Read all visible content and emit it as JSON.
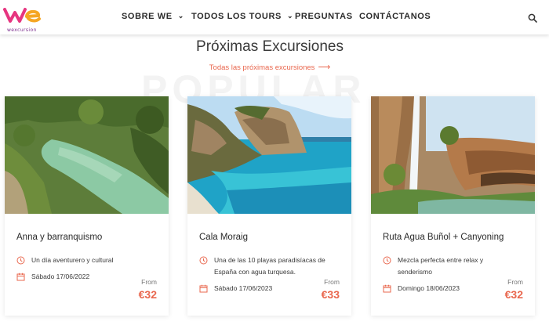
{
  "brand": {
    "logo_text": "wexcursion",
    "accent": "#e9674e",
    "logo_colors": [
      "#e63580",
      "#f5a623",
      "#7a2d8c"
    ]
  },
  "nav": {
    "items": [
      {
        "label": "SOBRE WE",
        "has_dropdown": true
      },
      {
        "label": "TODOS LOS TOURS",
        "has_dropdown": true
      },
      {
        "label": "PREGUNTAS",
        "has_dropdown": false
      },
      {
        "label": "CONTÁCTANOS",
        "has_dropdown": false
      }
    ],
    "search_icon": "search-icon"
  },
  "section": {
    "watermark": "POPULAR",
    "title": "Próximas Excursiones",
    "link": "Todas las próximas excursiones",
    "link_arrow": "⟶"
  },
  "cards": [
    {
      "title": "Anna y barranquismo",
      "description": "Un día aventurero y cultural",
      "date": "Sábado 17/06/2022",
      "from_label": "From",
      "price": "€32",
      "image": "green-lake-gorge"
    },
    {
      "title": "Cala Moraig",
      "description": "Una de las 10 playas paradisíacas de España con agua turquesa.",
      "date": "Sábado 17/06/2023",
      "from_label": "From",
      "price": "€33",
      "image": "turquoise-cove-cliffs"
    },
    {
      "title": "Ruta Agua Buñol + Canyoning",
      "description": "Mezcla perfecta entre relax y senderismo",
      "date": "Domingo 18/06/2023",
      "from_label": "From",
      "price": "€32",
      "image": "waterfall-canyon"
    }
  ]
}
